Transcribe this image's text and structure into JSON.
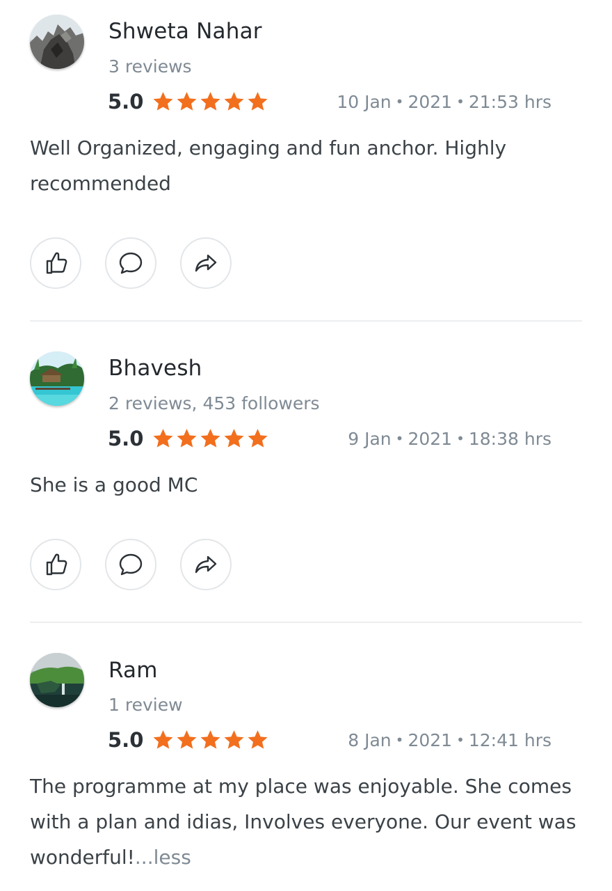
{
  "colors": {
    "star": "#f26f1e",
    "divider": "#eceef0",
    "muted": "#7f8a94"
  },
  "icons": {
    "like": "thumbs-up-icon",
    "comment": "speech-bubble-icon",
    "share": "share-arrow-icon",
    "star": "star-icon"
  },
  "reviews": [
    {
      "name": "Shweta Nahar",
      "sub": "3 reviews",
      "rating_text": "5.0",
      "stars": 5,
      "date": "10 Jan",
      "year": "2021",
      "time": "21:53 hrs",
      "text": "Well Organized, engaging and fun anchor. Highly recommended"
    },
    {
      "name": "Bhavesh",
      "sub": "2 reviews, 453 followers",
      "rating_text": "5.0",
      "stars": 5,
      "date": "9 Jan",
      "year": "2021",
      "time": "18:38 hrs",
      "text": "She is a good MC"
    },
    {
      "name": "Ram",
      "sub": "1 review",
      "rating_text": "5.0",
      "stars": 5,
      "date": "8 Jan",
      "year": "2021",
      "time": "12:41 hrs",
      "text": "The programme at my place was enjoyable. She comes with a plan and idias, Involves everyone. Our event was wonderful!",
      "less_label": "...less"
    }
  ]
}
